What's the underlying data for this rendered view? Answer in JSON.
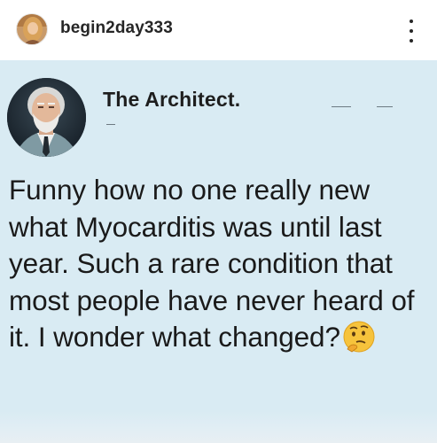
{
  "post": {
    "username": "begin2day333",
    "more_icon": "more-vertical-icon",
    "avatar_icon": "profile-photo"
  },
  "tweet": {
    "display_name": "The Architect.",
    "avatar_icon": "profile-photo-elderly-man",
    "text": "Funny how no one really new what Myocarditis was until last year. Such a rare condition that most people have never heard of it. I wonder what changed?",
    "emoji": "thinking-face-emoji"
  },
  "colors": {
    "image_background": "#d9ebf3",
    "username": "#262626",
    "tweet_text": "#1a1a1a",
    "emoji": "#f6c33c"
  }
}
